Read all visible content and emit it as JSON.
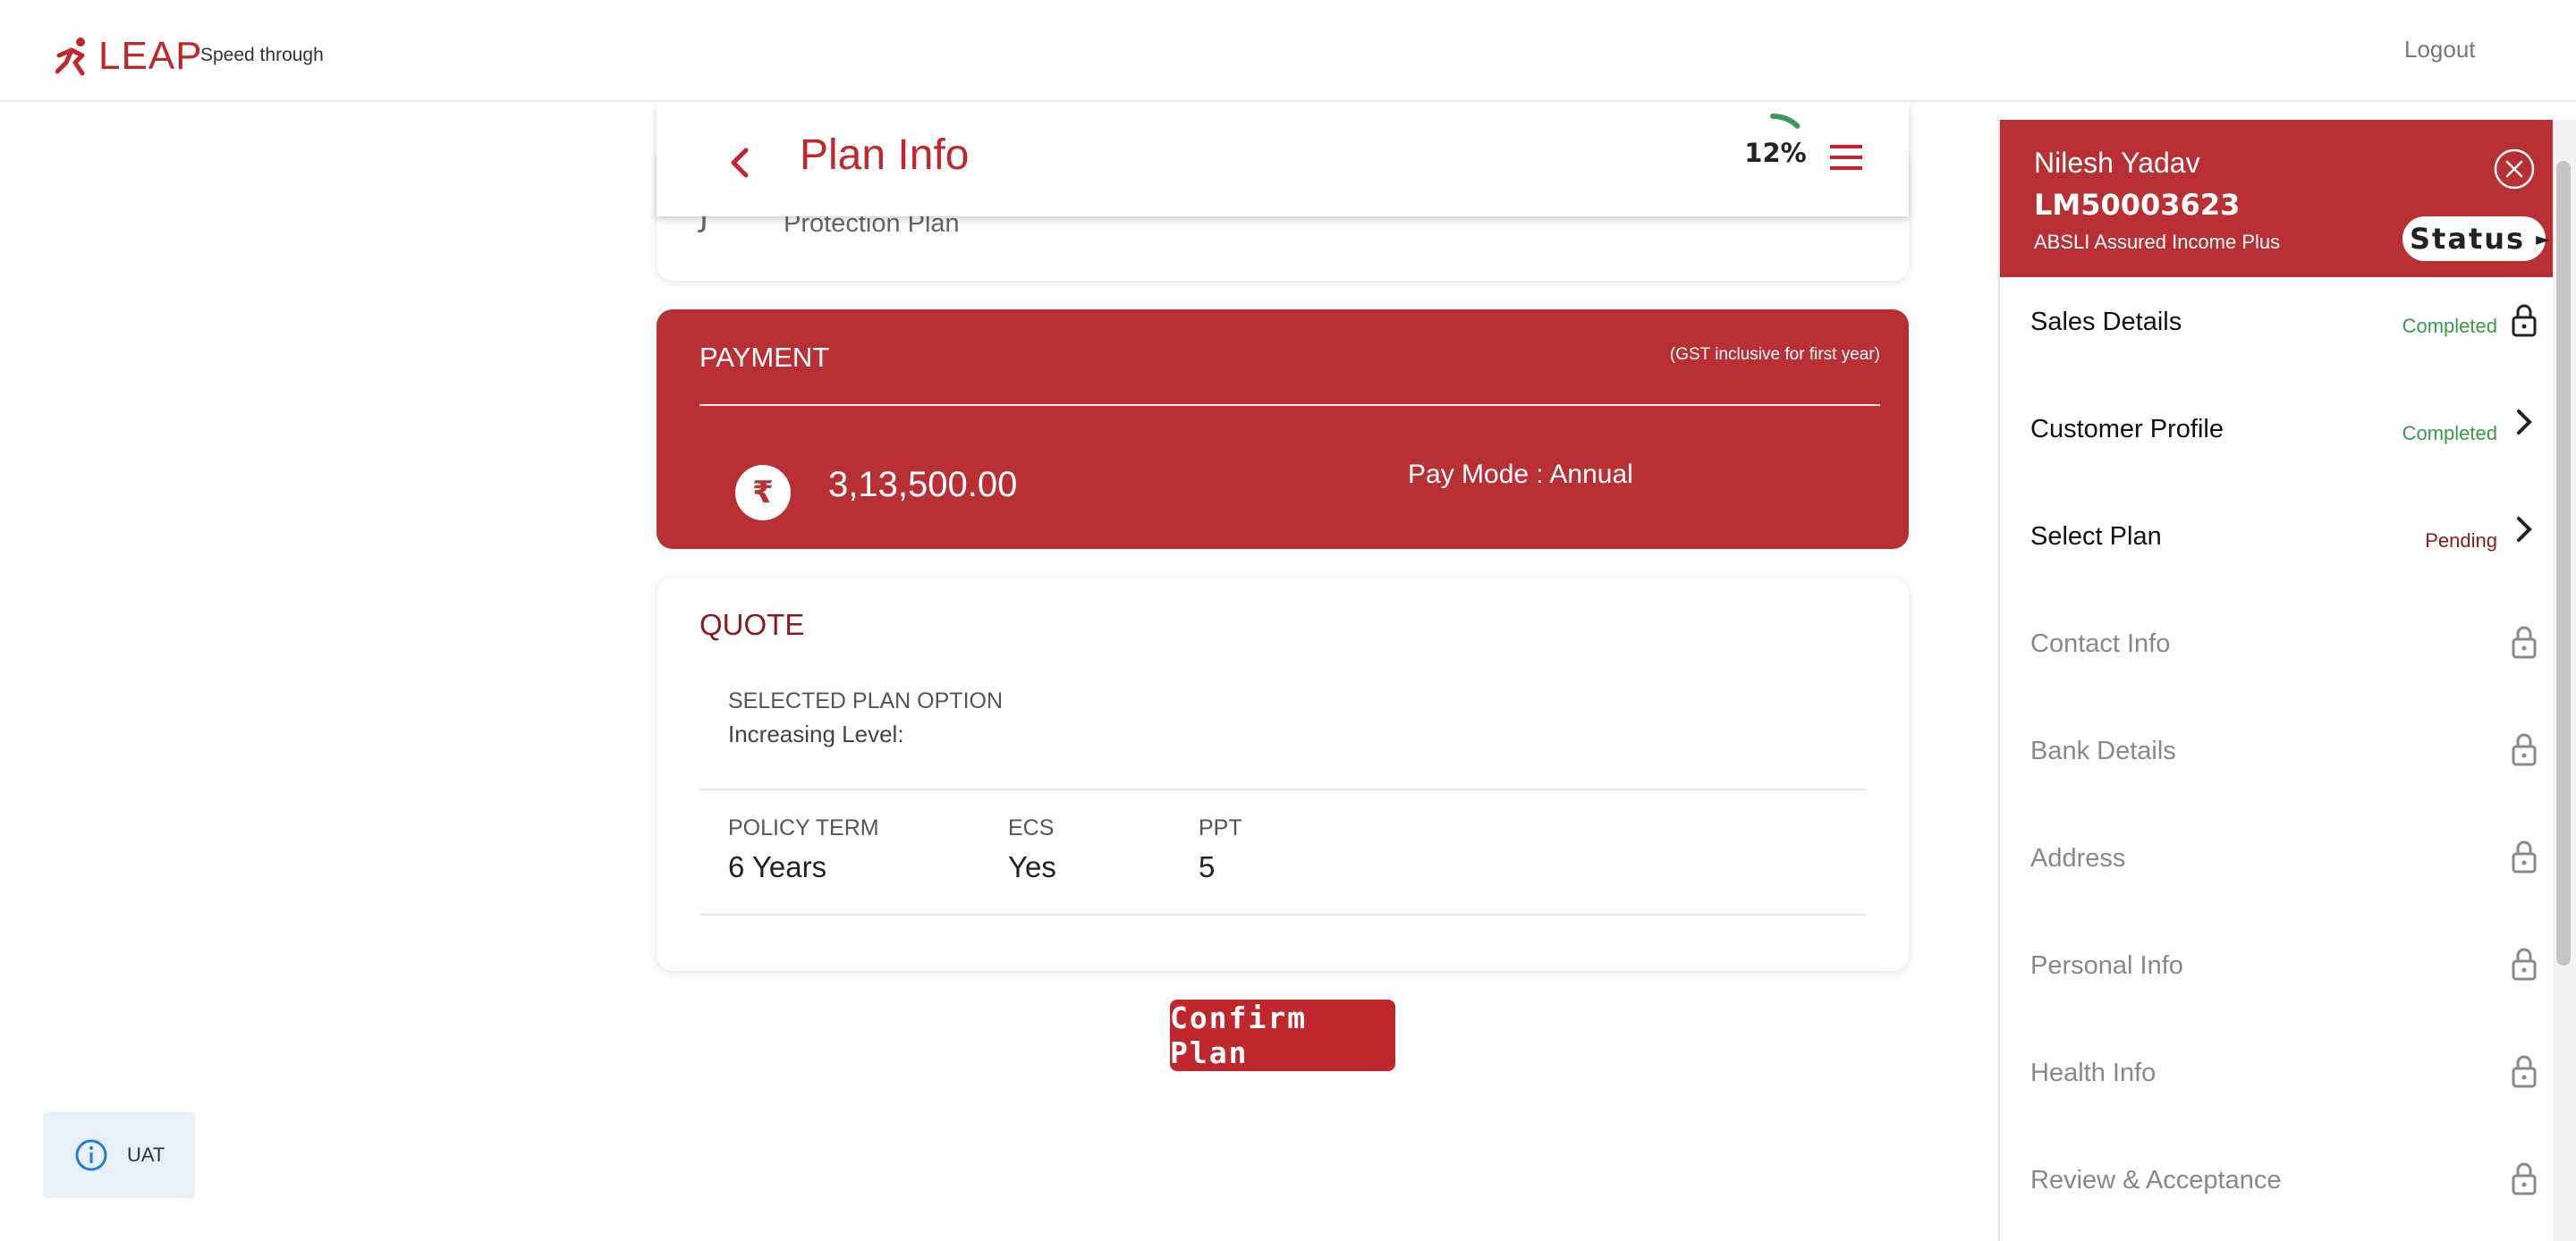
{
  "app": {
    "logo_text": "LEAP",
    "tagline": "Speed through",
    "logout_label": "Logout",
    "brand_color": "#c0272d"
  },
  "header": {
    "title": "Plan Info",
    "progress_percent": 12,
    "progress_label": "12%"
  },
  "plan_card": {
    "number": "J",
    "name": "Protection Plan"
  },
  "payment": {
    "title": "PAYMENT",
    "note": "(GST inclusive for first year)",
    "currency_symbol": "₹",
    "amount": "3,13,500.00",
    "pay_mode": "Pay Mode : Annual"
  },
  "quote": {
    "title": "QUOTE",
    "selected_plan_label": "SELECTED PLAN OPTION",
    "selected_plan_value": "Increasing Level:",
    "stats": [
      {
        "label": "POLICY TERM",
        "value": "6 Years"
      },
      {
        "label": "ECS",
        "value": "Yes"
      },
      {
        "label": "PPT",
        "value": "5"
      }
    ]
  },
  "confirm_label": "Confirm Plan",
  "env_badge": "UAT",
  "side": {
    "customer_name": "Nilesh Yadav",
    "customer_id": "LM50003623",
    "product": "ABSLI Assured Income Plus",
    "status_label": "Status",
    "steps": [
      {
        "label": "Sales Details",
        "status": "Completed",
        "icon": "lock-open-icon"
      },
      {
        "label": "Customer Profile",
        "status": "Completed",
        "icon": "chevron-right-icon"
      },
      {
        "label": "Select Plan",
        "status": "Pending",
        "icon": "chevron-right-icon"
      },
      {
        "label": "Contact Info",
        "status": "",
        "icon": "lock-icon"
      },
      {
        "label": "Bank Details",
        "status": "",
        "icon": "lock-icon"
      },
      {
        "label": "Address",
        "status": "",
        "icon": "lock-icon"
      },
      {
        "label": "Personal Info",
        "status": "",
        "icon": "lock-icon"
      },
      {
        "label": "Health Info",
        "status": "",
        "icon": "lock-icon"
      },
      {
        "label": "Review & Acceptance",
        "status": "",
        "icon": "lock-icon"
      }
    ],
    "completed_color": "#3a9a4a",
    "pending_color": "#8b1a1e"
  }
}
